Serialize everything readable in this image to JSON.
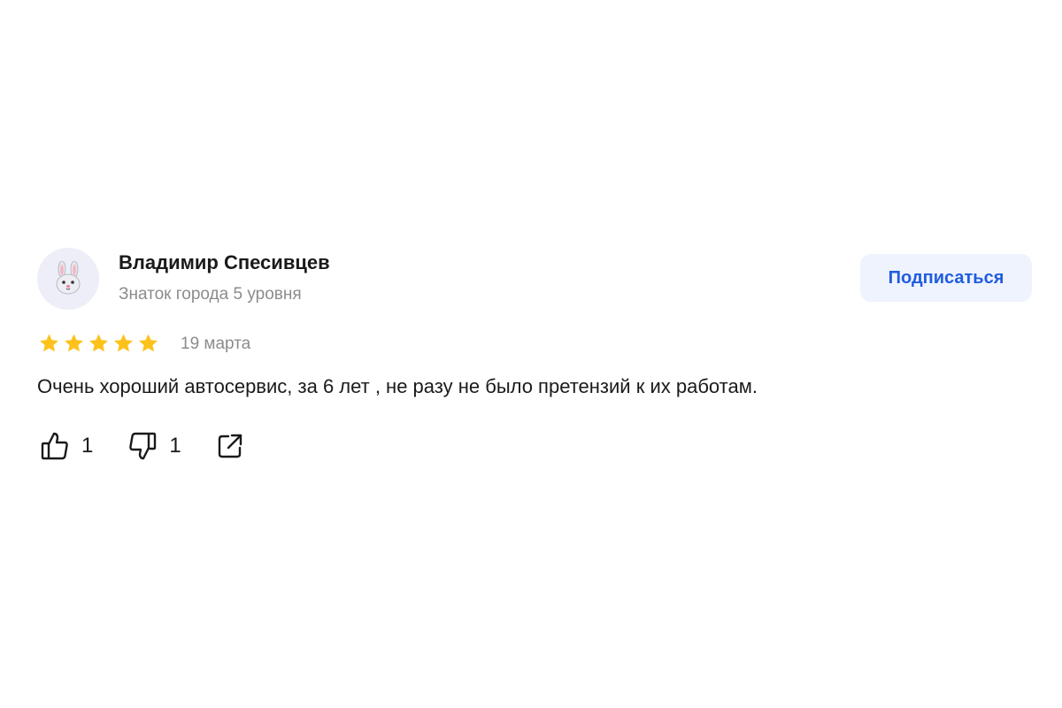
{
  "review": {
    "author": {
      "name": "Владимир Спесивцев",
      "level": "Знаток города 5 уровня",
      "avatar_icon": "rabbit-face-icon"
    },
    "subscribe_label": "Подписаться",
    "rating": 5,
    "rating_max": 5,
    "date": "19 марта",
    "text": "Очень хороший автосервис, за 6 лет , не разу не было претензий к их работам.",
    "likes": "1",
    "dislikes": "1",
    "icons": {
      "like": "thumbs-up-icon",
      "dislike": "thumbs-down-icon",
      "share": "share-icon"
    },
    "colors": {
      "star": "#fcc21b",
      "accent": "#1f5ce0",
      "button_bg": "#eff3fd",
      "muted": "#8c8c8c"
    }
  }
}
